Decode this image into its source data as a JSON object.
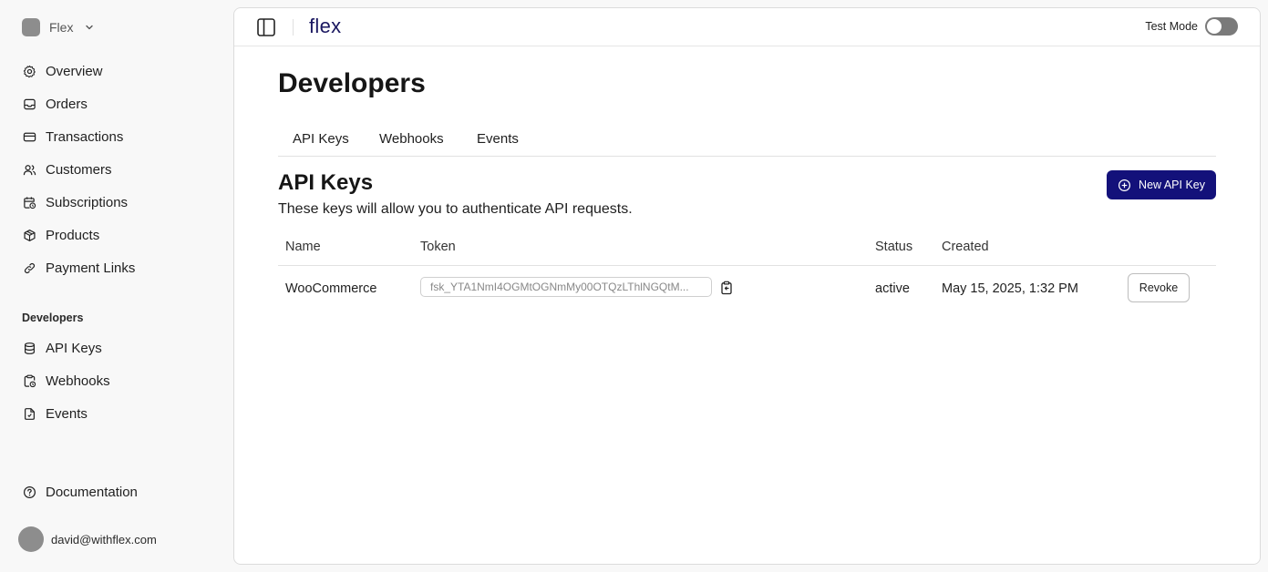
{
  "workspace": {
    "name": "Flex"
  },
  "sidebar": {
    "items": [
      {
        "label": "Overview",
        "icon": "gear-icon"
      },
      {
        "label": "Orders",
        "icon": "inbox-icon"
      },
      {
        "label": "Transactions",
        "icon": "credit-card-icon"
      },
      {
        "label": "Customers",
        "icon": "users-icon"
      },
      {
        "label": "Subscriptions",
        "icon": "calendar-clock-icon"
      },
      {
        "label": "Products",
        "icon": "package-icon"
      },
      {
        "label": "Payment Links",
        "icon": "link-icon"
      }
    ],
    "developers_title": "Developers",
    "developer_items": [
      {
        "label": "API Keys",
        "icon": "database-icon"
      },
      {
        "label": "Webhooks",
        "icon": "clipboard-clock-icon"
      },
      {
        "label": "Events",
        "icon": "file-icon"
      }
    ],
    "documentation": {
      "label": "Documentation",
      "icon": "help-circle-icon"
    },
    "user": {
      "email": "david@withflex.com"
    }
  },
  "topbar": {
    "brand": "flex",
    "test_mode_label": "Test Mode",
    "test_mode_on": false
  },
  "page": {
    "title": "Developers",
    "tabs": [
      "API Keys",
      "Webhooks",
      "Events"
    ],
    "section_title": "API Keys",
    "section_description": "These keys will allow you to authenticate API requests.",
    "new_key_label": "New API Key"
  },
  "table": {
    "headers": {
      "name": "Name",
      "token": "Token",
      "status": "Status",
      "created": "Created"
    },
    "rows": [
      {
        "name": "WooCommerce",
        "token": "fsk_YTA1NmI4OGMtOGNmMy00OTQzLThlNGQtM...",
        "status": "active",
        "created": "May 15, 2025, 1:32 PM",
        "action": "Revoke"
      }
    ]
  }
}
